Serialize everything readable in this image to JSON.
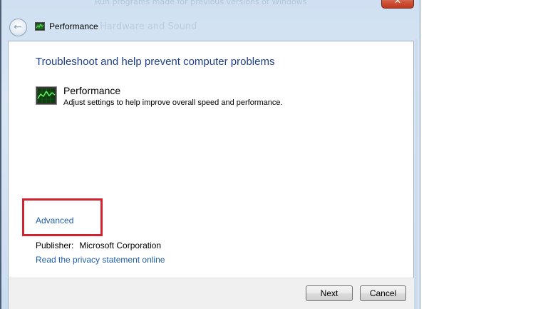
{
  "window": {
    "title": "Performance",
    "close_glyph": "✕",
    "background_text_1": "Run programs made for previous versions of Windows",
    "background_text_2": "Hardware and Sound"
  },
  "nav": {
    "back_icon": "back-arrow-icon",
    "back_glyph": "←"
  },
  "main": {
    "heading": "Troubleshoot and help prevent computer problems",
    "item": {
      "icon": "performance-monitor-icon",
      "name": "Performance",
      "description": "Adjust settings to help improve overall speed and performance."
    },
    "advanced_link": "Advanced",
    "publisher_label": "Publisher:",
    "publisher_value": "Microsoft Corporation",
    "privacy_link": "Read the privacy statement online"
  },
  "footer": {
    "next_label": "Next",
    "cancel_label": "Cancel"
  },
  "colors": {
    "heading": "#1e3f8a",
    "link": "#1f5ea8",
    "highlight": "#d1222e"
  }
}
